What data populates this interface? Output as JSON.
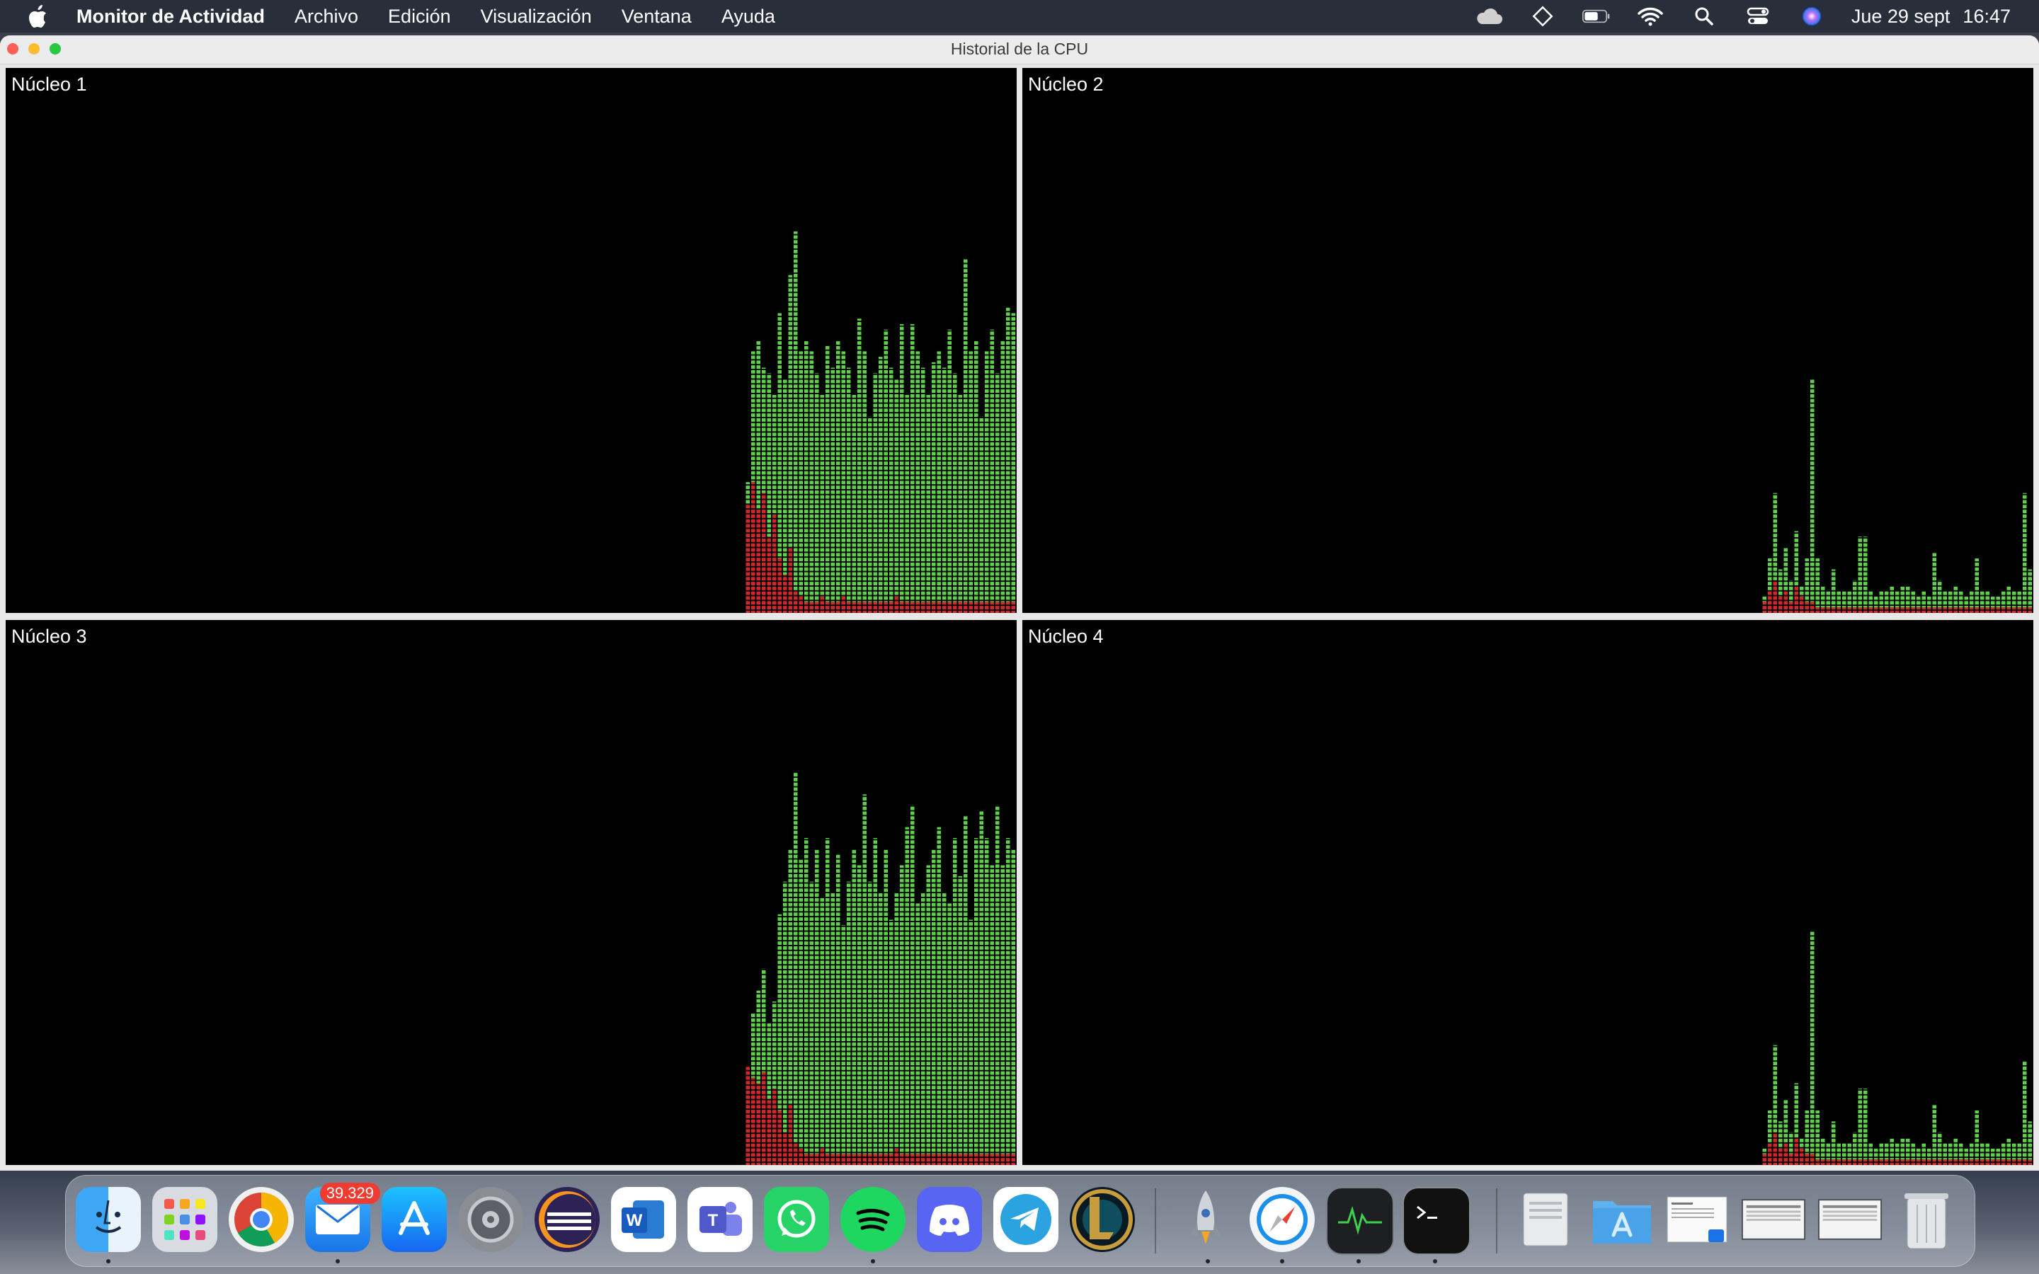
{
  "menubar": {
    "app_name": "Monitor de Actividad",
    "menus": [
      "Archivo",
      "Edición",
      "Visualización",
      "Ventana",
      "Ayuda"
    ],
    "status_icons": [
      "cloud-icon",
      "diamond-icon",
      "battery-icon",
      "wifi-icon",
      "search-icon",
      "control-center-icon",
      "siri-icon"
    ],
    "date": "Jue 29 sept",
    "time": "16:47"
  },
  "window": {
    "title": "Historial de la CPU"
  },
  "cores": [
    {
      "label": "Núcleo 1"
    },
    {
      "label": "Núcleo 2"
    },
    {
      "label": "Núcleo 3"
    },
    {
      "label": "Núcleo 4"
    }
  ],
  "colors": {
    "user": "#5fd04a",
    "system": "#d1262b",
    "panel_bg": "#000000"
  },
  "chart_data": [
    {
      "type": "bar",
      "title": "Núcleo 1",
      "ylim": [
        0,
        100
      ],
      "series": [
        {
          "name": "system",
          "values": [
            20,
            24,
            19,
            22,
            14,
            18,
            10,
            7,
            12,
            4,
            3,
            2,
            2,
            2,
            3,
            2,
            2,
            2,
            3,
            2,
            2,
            2,
            2,
            2,
            2,
            2,
            2,
            2,
            3,
            2,
            2,
            2,
            2,
            2,
            2,
            2,
            2,
            2,
            2,
            2,
            2,
            2,
            2,
            2,
            2,
            2,
            2,
            2,
            2,
            2,
            2
          ]
        },
        {
          "name": "total",
          "values": [
            24,
            48,
            50,
            45,
            44,
            40,
            55,
            43,
            62,
            70,
            48,
            50,
            48,
            44,
            40,
            49,
            45,
            50,
            48,
            45,
            40,
            54,
            48,
            36,
            44,
            47,
            52,
            45,
            43,
            53,
            40,
            53,
            48,
            45,
            40,
            46,
            48,
            45,
            52,
            44,
            40,
            65,
            48,
            50,
            36,
            48,
            52,
            44,
            50,
            56,
            55
          ]
        }
      ]
    },
    {
      "type": "bar",
      "title": "Núcleo 2",
      "ylim": [
        0,
        100
      ],
      "series": [
        {
          "name": "system",
          "values": [
            2,
            4,
            6,
            3,
            4,
            2,
            5,
            3,
            2,
            2,
            1,
            1,
            1,
            1,
            1,
            1,
            1,
            1,
            1,
            1,
            1,
            1,
            1,
            1,
            1,
            1,
            1,
            1,
            1,
            1,
            1,
            1,
            1,
            1,
            1,
            1,
            1,
            1,
            1,
            1,
            1,
            1,
            1,
            1,
            1,
            1,
            1,
            1,
            1,
            1,
            1
          ]
        },
        {
          "name": "total",
          "values": [
            3,
            10,
            22,
            8,
            12,
            6,
            15,
            5,
            10,
            43,
            10,
            5,
            4,
            8,
            4,
            4,
            4,
            6,
            14,
            14,
            4,
            3,
            4,
            4,
            5,
            4,
            5,
            5,
            4,
            3,
            4,
            3,
            11,
            6,
            4,
            4,
            5,
            4,
            3,
            4,
            10,
            4,
            4,
            3,
            3,
            4,
            5,
            4,
            4,
            22,
            8
          ]
        }
      ]
    },
    {
      "type": "bar",
      "title": "Núcleo 3",
      "ylim": [
        0,
        100
      ],
      "series": [
        {
          "name": "system",
          "values": [
            18,
            16,
            15,
            17,
            12,
            14,
            10,
            6,
            11,
            4,
            3,
            2,
            2,
            2,
            3,
            2,
            2,
            2,
            2,
            2,
            2,
            2,
            2,
            2,
            2,
            2,
            2,
            2,
            3,
            2,
            2,
            2,
            2,
            2,
            2,
            2,
            2,
            2,
            2,
            2,
            2,
            2,
            2,
            2,
            2,
            2,
            2,
            2,
            2,
            2,
            2
          ]
        },
        {
          "name": "total",
          "values": [
            16,
            28,
            32,
            36,
            26,
            30,
            46,
            52,
            58,
            72,
            56,
            60,
            52,
            58,
            49,
            60,
            50,
            57,
            44,
            52,
            58,
            55,
            68,
            52,
            60,
            50,
            58,
            45,
            50,
            55,
            62,
            66,
            48,
            50,
            55,
            58,
            62,
            50,
            48,
            60,
            53,
            64,
            45,
            60,
            65,
            60,
            55,
            66,
            55,
            60,
            58
          ]
        }
      ]
    },
    {
      "type": "bar",
      "title": "Núcleo 4",
      "ylim": [
        0,
        100
      ],
      "series": [
        {
          "name": "system",
          "values": [
            2,
            4,
            6,
            3,
            4,
            2,
            5,
            3,
            2,
            2,
            1,
            1,
            1,
            1,
            1,
            1,
            1,
            1,
            1,
            1,
            1,
            1,
            1,
            1,
            1,
            1,
            1,
            1,
            1,
            1,
            1,
            1,
            1,
            1,
            1,
            1,
            1,
            1,
            1,
            1,
            1,
            1,
            1,
            1,
            1,
            1,
            1,
            1,
            1,
            1,
            1
          ]
        },
        {
          "name": "total",
          "values": [
            3,
            10,
            22,
            8,
            12,
            6,
            15,
            5,
            10,
            43,
            10,
            5,
            4,
            8,
            4,
            4,
            4,
            6,
            14,
            14,
            4,
            3,
            4,
            4,
            5,
            4,
            5,
            5,
            4,
            3,
            4,
            3,
            11,
            6,
            4,
            4,
            5,
            4,
            3,
            4,
            10,
            4,
            4,
            3,
            3,
            4,
            5,
            4,
            4,
            19,
            8
          ]
        }
      ]
    }
  ],
  "dock": {
    "apps": [
      {
        "name": "finder-icon"
      },
      {
        "name": "launchpad-icon"
      },
      {
        "name": "chrome-icon"
      },
      {
        "name": "mail-icon",
        "badge": "39.329"
      },
      {
        "name": "app-store-icon"
      },
      {
        "name": "system-preferences-icon"
      },
      {
        "name": "eclipse-icon"
      },
      {
        "name": "word-icon"
      },
      {
        "name": "teams-icon"
      },
      {
        "name": "whatsapp-icon"
      },
      {
        "name": "spotify-icon"
      },
      {
        "name": "discord-icon"
      },
      {
        "name": "telegram-icon"
      },
      {
        "name": "league-of-legends-icon"
      },
      {
        "name": "rocket-icon"
      },
      {
        "name": "safari-icon"
      },
      {
        "name": "activity-monitor-icon"
      },
      {
        "name": "terminal-icon"
      },
      {
        "name": "docx-document-icon"
      },
      {
        "name": "applications-folder-icon"
      },
      {
        "name": "document-preview-icon"
      },
      {
        "name": "window-thumbnail-icon"
      },
      {
        "name": "window-thumbnail-icon"
      },
      {
        "name": "trash-icon"
      }
    ]
  }
}
